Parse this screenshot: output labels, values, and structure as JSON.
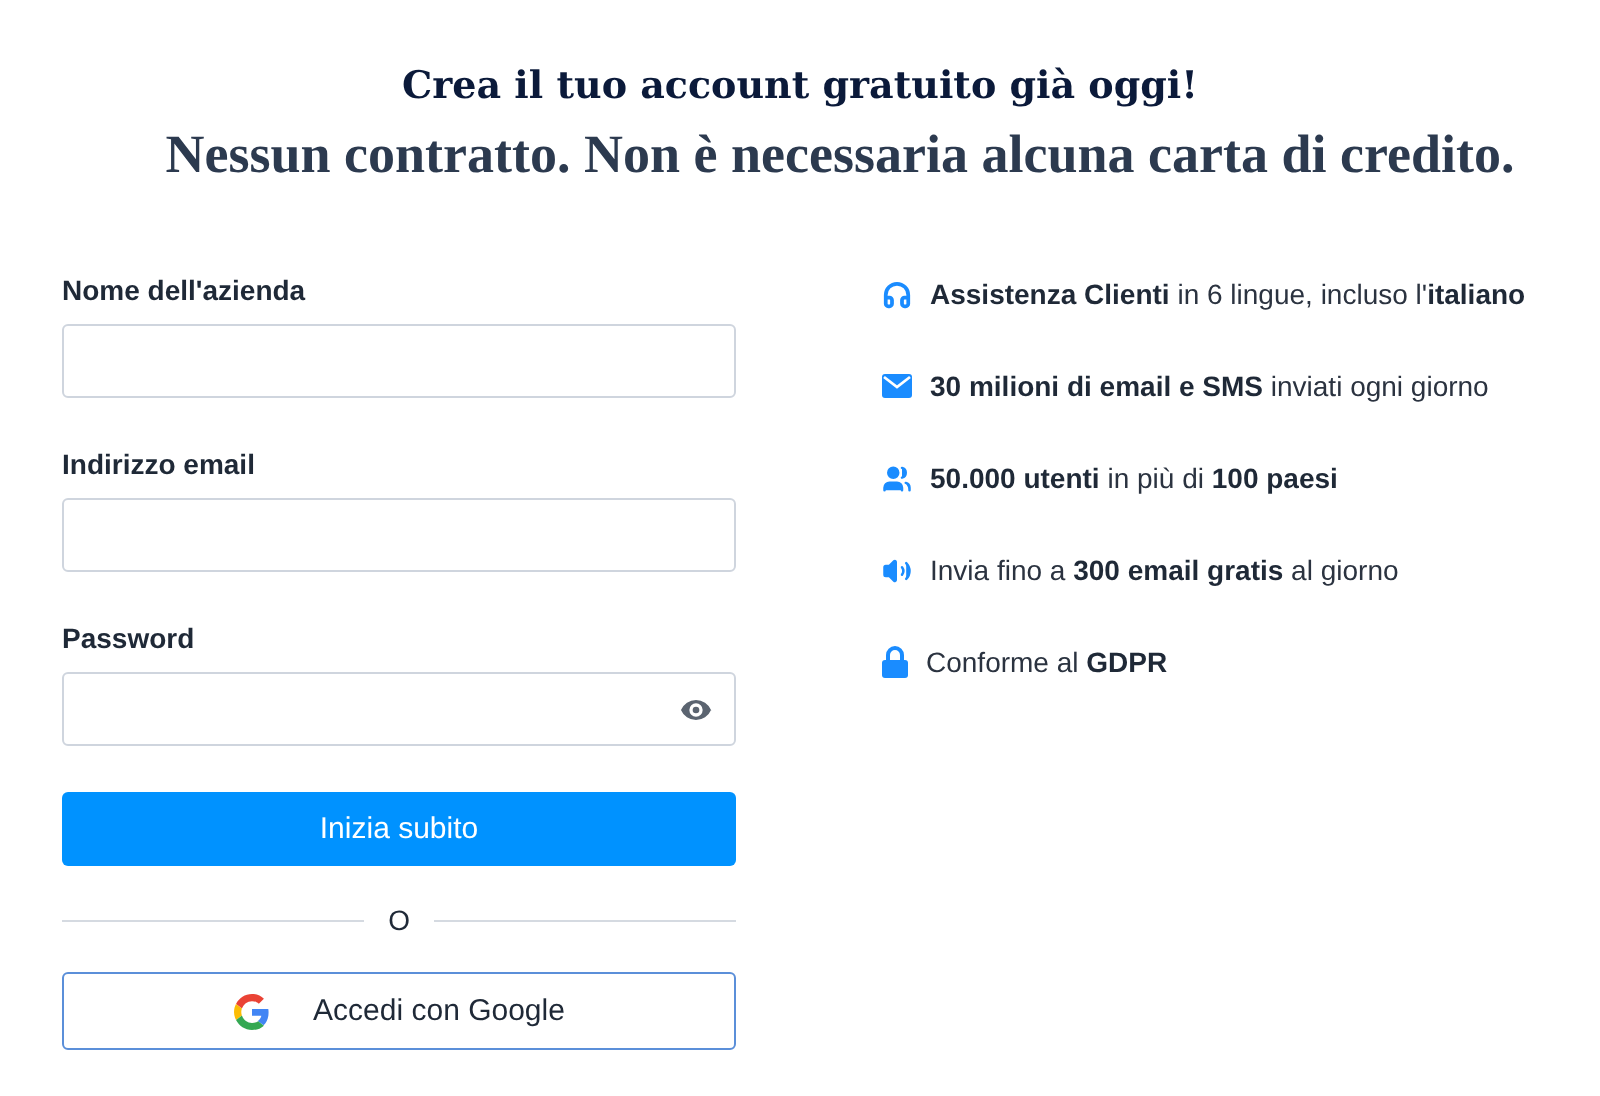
{
  "header": {
    "title": "Crea il tuo account gratuito già oggi!",
    "subtitle": "Nessun contratto. Non è necessaria alcuna carta di credito."
  },
  "form": {
    "fields": [
      {
        "label": "Nome dell'azienda",
        "kind": "text"
      },
      {
        "label": "Indirizzo email",
        "kind": "email"
      },
      {
        "label": "Password",
        "kind": "password"
      }
    ],
    "submit": "Inizia subito",
    "separator": "O",
    "google_button": "Accedi con Google"
  },
  "features": [
    {
      "kind": "headset",
      "text": "**Assistenza Clienti** in 6 lingue, incluso l'**italiano**"
    },
    {
      "kind": "envelope",
      "text": "**30 milioni di email e SMS** inviati ogni giorno"
    },
    {
      "kind": "users",
      "text": "**50.000 utenti** in più di **100 paesi**"
    },
    {
      "kind": "speaker",
      "text": "Invia fino a **300 email gratis** al giorno"
    },
    {
      "kind": "lock",
      "text": "Conforme al **GDPR**"
    }
  ]
}
